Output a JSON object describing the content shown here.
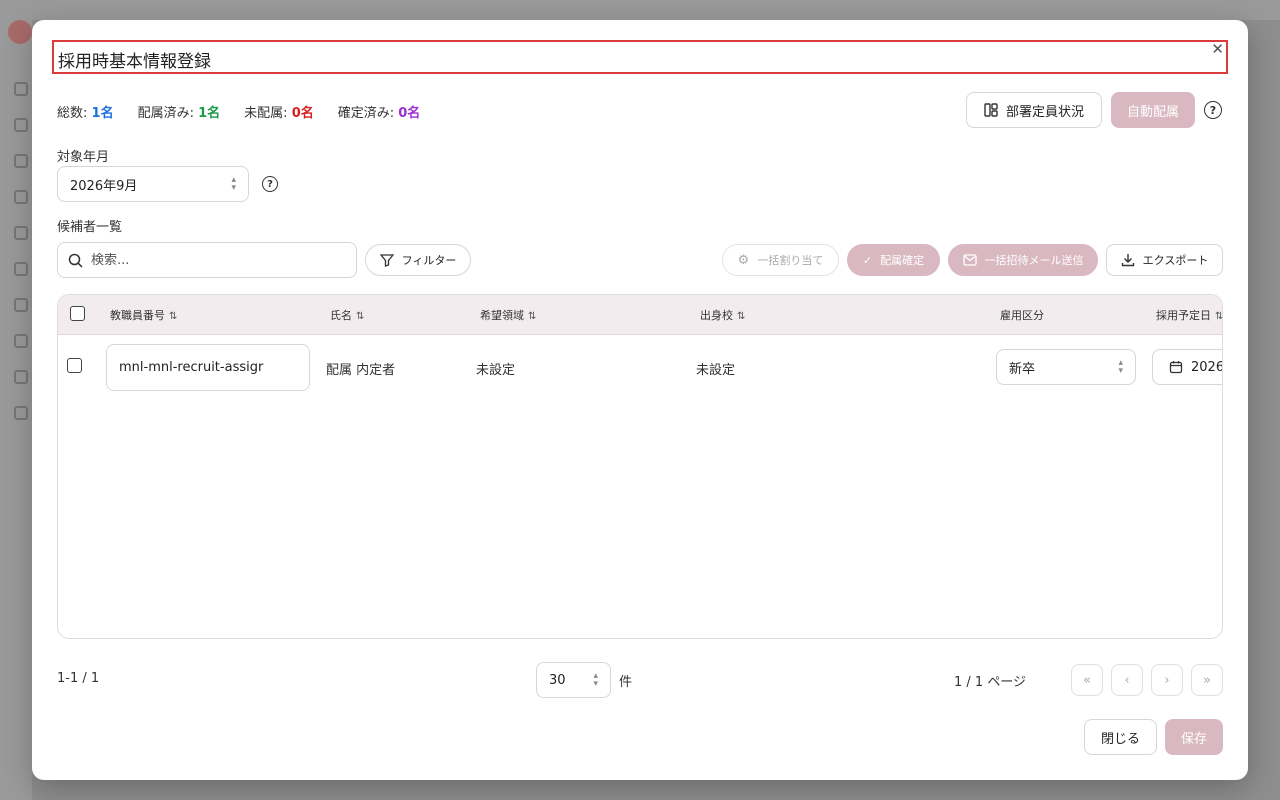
{
  "dialog": {
    "title": "採用時基本情報登録",
    "close_icon": "close-icon"
  },
  "stats": {
    "total_label": "総数:",
    "total_value": "1名",
    "assigned_label": "配属済み:",
    "assigned_value": "1名",
    "unassigned_label": "未配属:",
    "unassigned_value": "0名",
    "confirmed_label": "確定済み:",
    "confirmed_value": "0名"
  },
  "actions": {
    "dept_status_label": "部署定員状況",
    "auto_assign_label": "自動配属"
  },
  "target_month": {
    "label": "対象年月",
    "value": "2026年9月"
  },
  "candidates": {
    "label": "候補者一覧",
    "search_placeholder": "検索...",
    "filter_label": "フィルター",
    "bulk_assign_label": "一括割り当て",
    "confirm_assign_label": "配属確定",
    "bulk_invite_label": "一括招待メール送信",
    "export_label": "エクスポート"
  },
  "table": {
    "columns": {
      "staff_no": "教職員番号",
      "name": "氏名",
      "desired_area": "希望領域",
      "school": "出身校",
      "employment_type": "雇用区分",
      "planned_date": "採用予定日"
    },
    "rows": [
      {
        "staff_no": "mnl-mnl-recruit-assigr",
        "name": "配属 内定者",
        "desired_area": "未設定",
        "school": "未設定",
        "employment_type": "新卒",
        "planned_date": "2026"
      }
    ]
  },
  "pagination": {
    "range": "1-1 / 1",
    "page_size": "30",
    "page_size_unit": "件",
    "page_info": "1 / 1 ページ"
  },
  "footer": {
    "close_label": "閉じる",
    "save_label": "保存"
  },
  "colors": {
    "accent_pink": "#d9b8c1",
    "title_border": "#d93b3b",
    "blue": "#1f6fe0",
    "green": "#1a9a4b",
    "red": "#d61f1f",
    "purple": "#9b2fd8"
  }
}
